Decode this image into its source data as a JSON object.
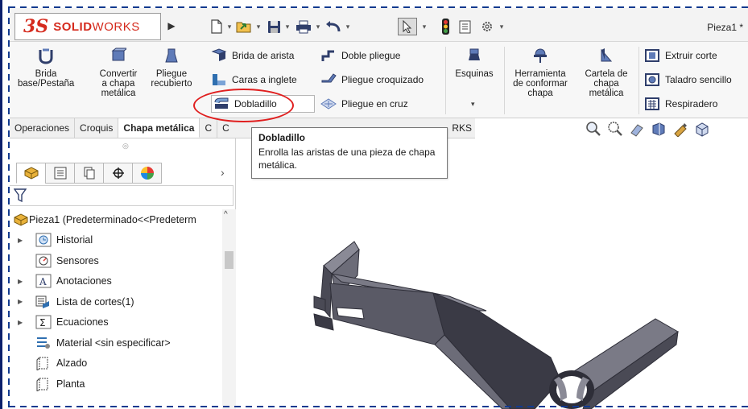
{
  "app": {
    "logo": {
      "mark": "3S",
      "text_bold": "SOLID",
      "text_rest": "WORKS"
    },
    "document_title": "Pieza1 *"
  },
  "quick_access": [
    {
      "icon": "new-document-icon"
    },
    {
      "icon": "open-folder-icon"
    },
    {
      "icon": "save-icon"
    },
    {
      "icon": "print-icon"
    },
    {
      "icon": "undo-icon"
    },
    {
      "icon": "select-arrow-icon"
    },
    {
      "icon": "rebuild-traffic-light-icon"
    },
    {
      "icon": "file-properties-icon"
    },
    {
      "icon": "options-gear-icon"
    }
  ],
  "ribbon": {
    "brida_base": "Brida\nbase/Pestaña",
    "convertir": "Convertir\na chapa\nmetálica",
    "pliegue_recubierto": "Pliegue\nrecubierto",
    "brida_arista": "Brida de arista",
    "caras_inglete": "Caras a inglete",
    "dobladillo": "Dobladillo",
    "doble_pliegue": "Doble pliegue",
    "pliegue_croquizado": "Pliegue croquizado",
    "pliegue_cruz": "Pliegue en cruz",
    "esquinas": "Esquinas",
    "herramienta": "Herramienta\nde conformar\nchapa",
    "cartela": "Cartela de\nchapa\nmetálica",
    "extruir_corte": "Extruir corte",
    "taladro_sencillo": "Taladro sencillo",
    "respiradero": "Respiradero"
  },
  "tabs": [
    {
      "label": "Operaciones",
      "active": false
    },
    {
      "label": "Croquis",
      "active": false
    },
    {
      "label": "Chapa metálica",
      "active": true
    },
    {
      "label": "C",
      "active": false
    },
    {
      "label": "C",
      "active": false
    }
  ],
  "tab_behind_tooltip": "RKS",
  "tooltip": {
    "title": "Dobladillo",
    "body": "Enrolla las aristas de una pieza de chapa metálica."
  },
  "feature_manager": {
    "tree": [
      {
        "label": "Pieza1  (Predeterminado<<Predeterm",
        "icon": "part-icon",
        "expandable": false,
        "level": 0
      },
      {
        "label": "Historial",
        "icon": "history-folder-icon",
        "expandable": true,
        "level": 1
      },
      {
        "label": "Sensores",
        "icon": "sensors-folder-icon",
        "expandable": false,
        "level": 1
      },
      {
        "label": "Anotaciones",
        "icon": "annotations-folder-icon",
        "expandable": true,
        "level": 1
      },
      {
        "label": "Lista de cortes(1)",
        "icon": "cut-list-icon",
        "expandable": true,
        "level": 1
      },
      {
        "label": "Ecuaciones",
        "icon": "equations-folder-icon",
        "expandable": true,
        "level": 1
      },
      {
        "label": "Material <sin especificar>",
        "icon": "material-icon",
        "expandable": false,
        "level": 1
      },
      {
        "label": "Alzado",
        "icon": "plane-icon",
        "expandable": false,
        "level": 1
      },
      {
        "label": "Planta",
        "icon": "plane-icon",
        "expandable": false,
        "level": 1
      }
    ]
  },
  "colors": {
    "model_face": "#5a5a66",
    "model_light": "#8a8a96",
    "model_dark": "#2e2e38",
    "highlight_ring": "#e01f1f",
    "brand_red": "#d52b1e"
  }
}
